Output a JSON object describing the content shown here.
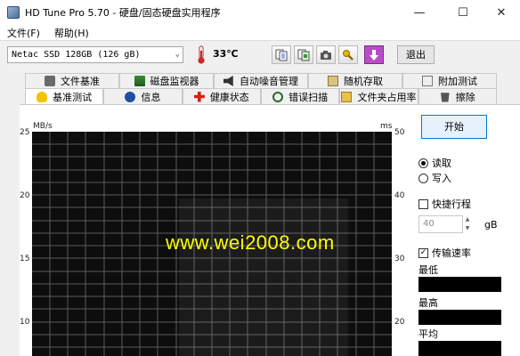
{
  "window": {
    "title": "HD Tune Pro 5.70 - 硬盘/固态硬盘实用程序",
    "min_symbol": "—",
    "max_symbol": "☐",
    "close_symbol": "✕"
  },
  "menu": {
    "items": [
      "文件(F)",
      "帮助(H)"
    ]
  },
  "toolbar": {
    "drive": "Netac SSD 128GB (126 gB)",
    "temperature": "33℃",
    "exit_label": "退出",
    "buttons": [
      "copy-info-icon",
      "copy-screen-icon",
      "camera-icon",
      "options-icon",
      "save-download-icon"
    ]
  },
  "tabs": {
    "row1": [
      "文件基准",
      "磁盘监视器",
      "自动噪音管理",
      "随机存取",
      "附加测试"
    ],
    "row2": [
      "基准测试",
      "信息",
      "健康状态",
      "错误扫描",
      "文件夹占用率",
      "擦除"
    ],
    "active": "基准测试"
  },
  "chart": {
    "left_unit": "MB/s",
    "right_unit": "ms",
    "left_ticks": [
      "25",
      "20",
      "15",
      "10"
    ],
    "right_ticks": [
      "50",
      "40",
      "30",
      "20"
    ]
  },
  "watermark": "www.wei2008.com",
  "controls": {
    "start_label": "开始",
    "read_label": "读取",
    "write_label": "写入",
    "short_stroke_label": "快捷行程",
    "stroke_value": "40",
    "stroke_unit": "gB",
    "transfer_rate_label": "传输速率",
    "min_label": "最低",
    "max_label": "最高",
    "avg_label": "平均"
  },
  "colors": {
    "chart_bg": "#0d0d0d",
    "grid": "#5a5a5a",
    "watermark": "#ffff00",
    "accent": "#0078d7"
  }
}
